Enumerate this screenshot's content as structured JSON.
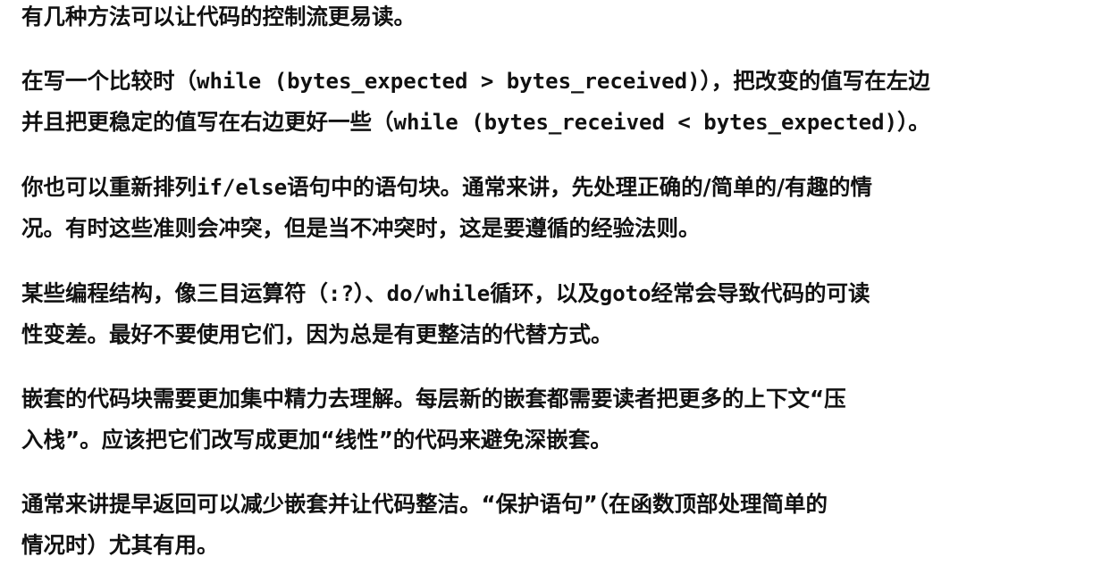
{
  "paragraphs": [
    {
      "lines": [
        [
          {
            "t": "有几种方法可以让代码的控制流更易读。",
            "code": false
          }
        ]
      ]
    },
    {
      "lines": [
        [
          {
            "t": "在写一个比较时（",
            "code": false
          },
          {
            "t": "while (bytes_expected > bytes_received)",
            "code": true
          },
          {
            "t": "），把改变的值写在左边",
            "code": false
          }
        ],
        [
          {
            "t": "并且把更稳定的值写在右边更好一些（",
            "code": false
          },
          {
            "t": "while (bytes_received < bytes_expected)",
            "code": true
          },
          {
            "t": "）。",
            "code": false
          }
        ]
      ]
    },
    {
      "lines": [
        [
          {
            "t": "你也可以重新排列",
            "code": false
          },
          {
            "t": "if/else",
            "code": true
          },
          {
            "t": "语句中的语句块。通常来讲，先处理正确的/简单的/有趣的情",
            "code": false
          }
        ],
        [
          {
            "t": "况。有时这些准则会冲突，但是当不冲突时，这是要遵循的经验法则。",
            "code": false
          }
        ]
      ]
    },
    {
      "lines": [
        [
          {
            "t": "某些编程结构，像三目运算符（",
            "code": false
          },
          {
            "t": ":?",
            "code": true
          },
          {
            "t": "）、",
            "code": false
          },
          {
            "t": "do/while",
            "code": true
          },
          {
            "t": "循环，以及",
            "code": false
          },
          {
            "t": "goto",
            "code": true
          },
          {
            "t": "经常会导致代码的可读",
            "code": false
          }
        ],
        [
          {
            "t": "性变差。最好不要使用它们，因为总是有更整洁的代替方式。",
            "code": false
          }
        ]
      ]
    },
    {
      "lines": [
        [
          {
            "t": "嵌套的代码块需要更加集中精力去理解。每层新的嵌套都需要读者把更多的上下文“压",
            "code": false
          }
        ],
        [
          {
            "t": "入栈”。应该把它们改写成更加“线性”的代码来避免深嵌套。",
            "code": false
          }
        ]
      ]
    },
    {
      "lines": [
        [
          {
            "t": "通常来讲提早返回可以减少嵌套并让代码整洁。“保护语句”（在函数顶部处理简单的",
            "code": false
          }
        ],
        [
          {
            "t": "情况时）尤其有用。",
            "code": false
          }
        ]
      ]
    }
  ]
}
